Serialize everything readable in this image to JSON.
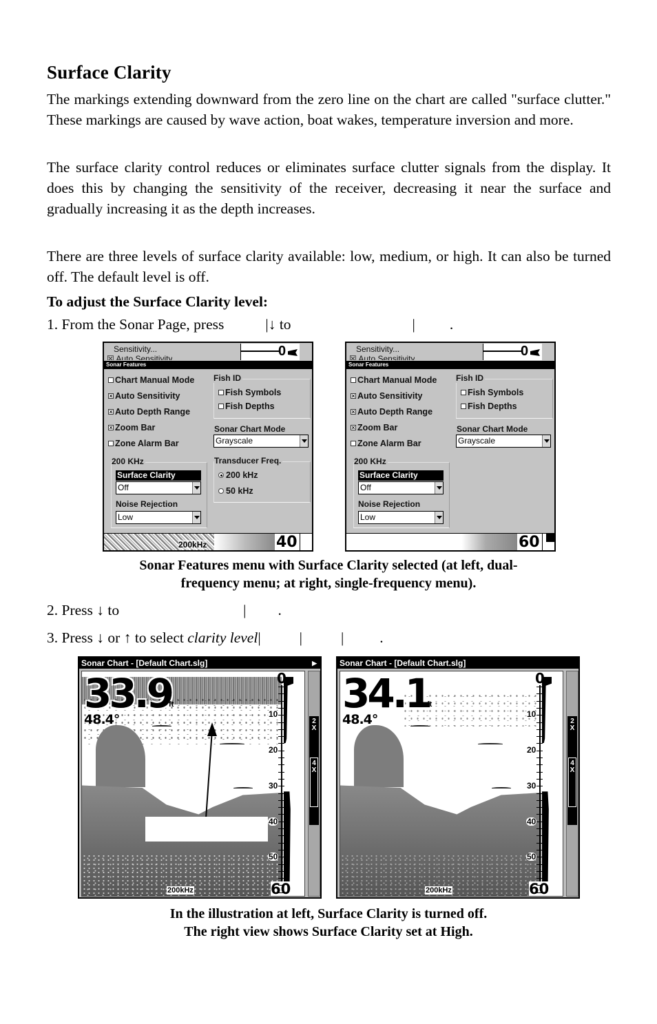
{
  "document": {
    "heading": "Surface Clarity",
    "paragraphs": [
      "The markings extending downward from the zero line on the chart are called \"surface clutter.\" These markings are caused by wave action, boat wakes, temperature inversion and more.",
      "The surface clarity control reduces or eliminates surface clutter signals from the display. It does this by changing the sensitivity of the receiver, decreasing it near the surface and gradually increasing it as the depth increases.",
      "There are three levels of surface clarity available: low, medium, or high. It can also be turned off. The default level is off."
    ],
    "procedure_title": "To adjust the Surface Clarity level:",
    "steps": {
      "step1_prefix": "1. From the Sonar Page, press",
      "step1_sep1": "|",
      "step1_arrow": "↓",
      "step1_to": " to",
      "step1_sep2": "|",
      "step1_end": ".",
      "step2_prefix": "2. Press ",
      "step2_arrow": "↓",
      "step2_to": " to",
      "step2_sep": "|",
      "step2_end": ".",
      "step3_prefix": "3. Press ",
      "step3_down": "↓",
      "step3_or": " or ",
      "step3_up": "↑",
      "step3_select": " to select ",
      "step3_italic": "clarity level",
      "step3_sep": "|",
      "step3_end": "."
    },
    "captions": {
      "menus": [
        "Sonar Features menu with Surface Clarity selected (at left, dual-",
        "frequency menu; at right, single-frequency menu)."
      ],
      "charts": [
        "In the illustration at left, Surface Clarity is turned off.",
        "The right view shows Surface Clarity set at High."
      ]
    }
  },
  "menus": [
    {
      "bg_item1": "Sensitivity...",
      "bg_item2": "☒ Auto Sensitivity",
      "bg_zero": "0",
      "title": "Sonar Features",
      "checkboxes": [
        {
          "label": "Chart Manual Mode",
          "checked": false
        },
        {
          "label": "Auto Sensitivity",
          "checked": true
        },
        {
          "label": "Auto Depth Range",
          "checked": true
        },
        {
          "label": "Zoom Bar",
          "checked": true
        },
        {
          "label": "Zone Alarm Bar",
          "checked": false
        }
      ],
      "fish_id": {
        "label": "Fish ID",
        "items": [
          {
            "label": "Fish Symbols",
            "checked": false
          },
          {
            "label": "Fish Depths",
            "checked": false
          }
        ]
      },
      "chart_mode": {
        "label": "Sonar Chart Mode",
        "value": "Grayscale"
      },
      "freq_group": "200 KHz",
      "surface_clarity": {
        "label": "Surface Clarity",
        "value": "Off"
      },
      "noise_rejection": {
        "label": "Noise Rejection",
        "value": "Low"
      },
      "transducer": {
        "label": "Transducer Freq.",
        "options": [
          {
            "label": "200 kHz",
            "selected": true
          },
          {
            "label": "50 kHz",
            "selected": false
          }
        ]
      },
      "status_freq": "200kHz",
      "status_depth": "40"
    },
    {
      "bg_item1": "Sensitivity...",
      "bg_item2": "☒ Auto Sensitivity",
      "bg_zero": "0",
      "title": "Sonar Features",
      "checkboxes": [
        {
          "label": "Chart Manual Mode",
          "checked": false
        },
        {
          "label": "Auto Sensitivity",
          "checked": true
        },
        {
          "label": "Auto Depth Range",
          "checked": true
        },
        {
          "label": "Zoom Bar",
          "checked": true
        },
        {
          "label": "Zone Alarm Bar",
          "checked": false
        }
      ],
      "fish_id": {
        "label": "Fish ID",
        "items": [
          {
            "label": "Fish Symbols",
            "checked": false
          },
          {
            "label": "Fish Depths",
            "checked": false
          }
        ]
      },
      "chart_mode": {
        "label": "Sonar Chart Mode",
        "value": "Grayscale"
      },
      "freq_group": "200 KHz",
      "surface_clarity": {
        "label": "Surface Clarity",
        "value": "Off"
      },
      "noise_rejection": {
        "label": "Noise Rejection",
        "value": "Low"
      },
      "status_depth": "60"
    }
  ],
  "charts": [
    {
      "title": "Sonar Chart - [Default Chart.slg]",
      "play_icon": "▶",
      "depth": "33.9",
      "unit": "ft",
      "temperature": "48.4°",
      "scale_top": "0",
      "scale_labels": [
        "10",
        "20",
        "30",
        "40",
        "50"
      ],
      "scale_bottom": "60",
      "frequency": "200kHz",
      "zoom_levels": [
        "2 X",
        "4 X"
      ],
      "surface_clarity": "Off"
    },
    {
      "title": "Sonar Chart - [Default Chart.slg]",
      "depth": "34.1",
      "unit": "ft",
      "temperature": "48.4°",
      "scale_top": "0",
      "scale_labels": [
        "10",
        "20",
        "30",
        "40",
        "50"
      ],
      "scale_bottom": "60",
      "frequency": "200kHz",
      "zoom_levels": [
        "2 X",
        "4 X"
      ],
      "surface_clarity": "High"
    }
  ]
}
